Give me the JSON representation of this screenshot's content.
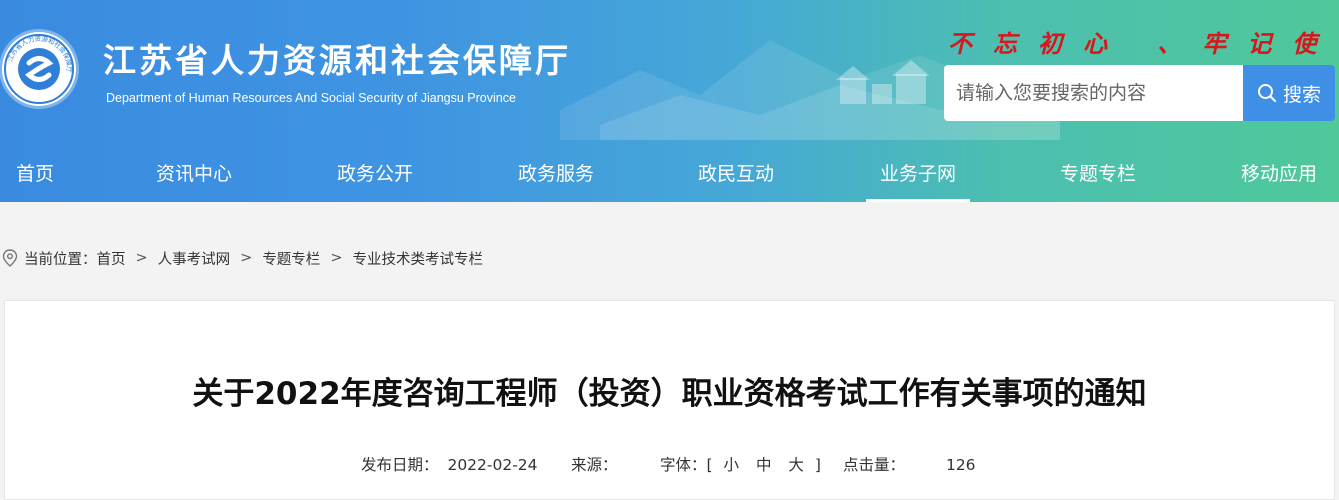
{
  "header": {
    "site_title": "江苏省人力资源和社会保障厅",
    "site_subtitle": "Department of Human Resources And Social Security of Jiangsu Province",
    "logo_text": "江苏省人力资源和社会保障厅",
    "slogan": "不忘初心 、牢记使命",
    "search_placeholder": "请输入您要搜索的内容",
    "search_button": "搜索"
  },
  "nav": {
    "items": [
      {
        "label": "首页"
      },
      {
        "label": "资讯中心"
      },
      {
        "label": "政务公开"
      },
      {
        "label": "政务服务"
      },
      {
        "label": "政民互动"
      },
      {
        "label": "业务子网"
      },
      {
        "label": "专题专栏"
      },
      {
        "label": "移动应用"
      }
    ],
    "active": "业务子网"
  },
  "breadcrumb": {
    "prefix": "当前位置：",
    "items": [
      "首页",
      "人事考试网",
      "专题专栏",
      "专业技术类考试专栏"
    ],
    "separator": ">"
  },
  "article": {
    "title": "关于2022年度咨询工程师（投资）职业资格考试工作有关事项的通知",
    "date_label": "发布日期：",
    "date": "2022-02-24",
    "source_label": "来源：",
    "source": "",
    "font_label": "字体：[",
    "font_small": "小",
    "font_medium": "中",
    "font_large": "大",
    "font_close": "]",
    "hits_label": "点击量：",
    "hits": "126"
  },
  "colors": {
    "header_start": "#3a8be0",
    "header_end": "#4fc89a",
    "slogan": "#d8161b",
    "search_button": "#3f8fe6"
  }
}
